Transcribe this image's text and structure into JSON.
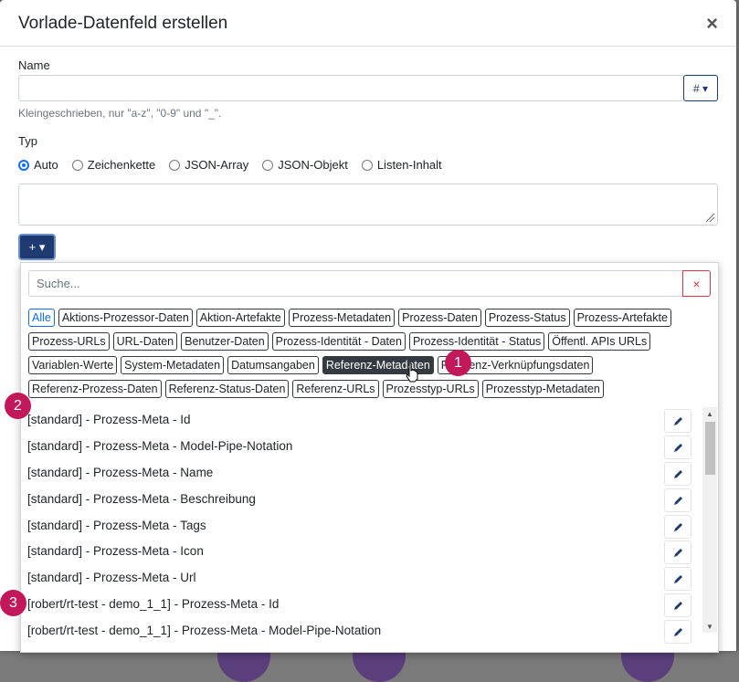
{
  "modal": {
    "title": "Vorlade-Datenfeld erstellen",
    "close": "×"
  },
  "name_field": {
    "label": "Name",
    "value": "",
    "placeholder": "",
    "hash_btn": "# ▾",
    "hint": "Kleingeschrieben, nur \"a-z\", \"0-9\" und \"_\"."
  },
  "type_field": {
    "label": "Typ",
    "options": [
      "Auto",
      "Zeichenkette",
      "JSON-Array",
      "JSON-Objekt",
      "Listen-Inhalt"
    ],
    "selected": "Auto"
  },
  "content_area": {
    "value": ""
  },
  "plus_btn": "+ ▾",
  "dropdown": {
    "search_placeholder": "Suche...",
    "clear_icon": "×",
    "chip_rows": [
      [
        "Alle",
        "Aktions-Prozessor-Daten",
        "Aktion-Artefakte",
        "Prozess-Metadaten",
        "Prozess-Daten",
        "Prozess-Status",
        "Prozess-Artefakte"
      ],
      [
        "Prozess-URLs",
        "URL-Daten",
        "Benutzer-Daten",
        "Prozess-Identität - Daten",
        "Prozess-Identität - Status",
        "Öffentl. APIs URLs"
      ],
      [
        "Variablen-Werte",
        "System-Metadaten",
        "Datumsangaben",
        "Referenz-Metadaten",
        "Referenz-Verknüpfungsdaten"
      ],
      [
        "Referenz-Prozess-Daten",
        "Referenz-Status-Daten",
        "Referenz-URLs",
        "Prozesstyp-URLs",
        "Prozesstyp-Metadaten"
      ]
    ],
    "items": [
      "[standard] - Prozess-Meta - Id",
      "[standard] - Prozess-Meta - Model-Pipe-Notation",
      "[standard] - Prozess-Meta - Name",
      "[standard] - Prozess-Meta - Beschreibung",
      "[standard] - Prozess-Meta - Tags",
      "[standard] - Prozess-Meta - Icon",
      "[standard] - Prozess-Meta - Url",
      "[robert/rt-test - demo_1_1] - Prozess-Meta - Id",
      "[robert/rt-test - demo_1_1] - Prozess-Meta - Model-Pipe-Notation"
    ]
  },
  "badges": [
    "1",
    "2",
    "3"
  ],
  "colors": {
    "primary": "#1e3a70",
    "radio": "#0d6efd",
    "danger": "#dc3545",
    "badge": "#c2185b",
    "active_chip": "#343a40"
  }
}
